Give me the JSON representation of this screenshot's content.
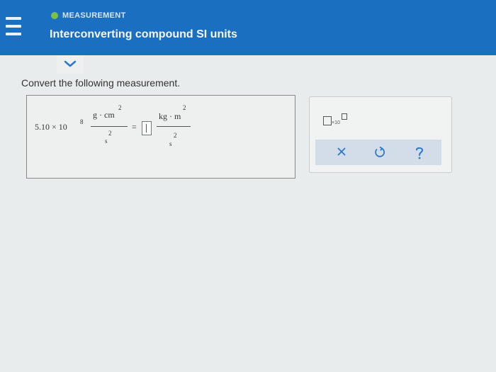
{
  "header": {
    "topic": "MEASUREMENT",
    "title": "Interconverting compound SI units"
  },
  "question": {
    "prompt": "Convert the following measurement."
  },
  "expression": {
    "coefficient": "5.10 × 10",
    "exponent": "8",
    "given_num_unit": "g · cm",
    "given_num_exp": "2",
    "given_den_unit": "s",
    "given_den_exp": "2",
    "equals": "=",
    "target_num_unit": "kg · m",
    "target_num_exp": "2",
    "target_den_unit": "s",
    "target_den_exp": "2"
  },
  "tools": {
    "sci_notation_label": "×10"
  },
  "colors": {
    "header_bg": "#1b6fc1",
    "topic_dot": "#7bc143",
    "help_icon": "#2b78c8"
  }
}
